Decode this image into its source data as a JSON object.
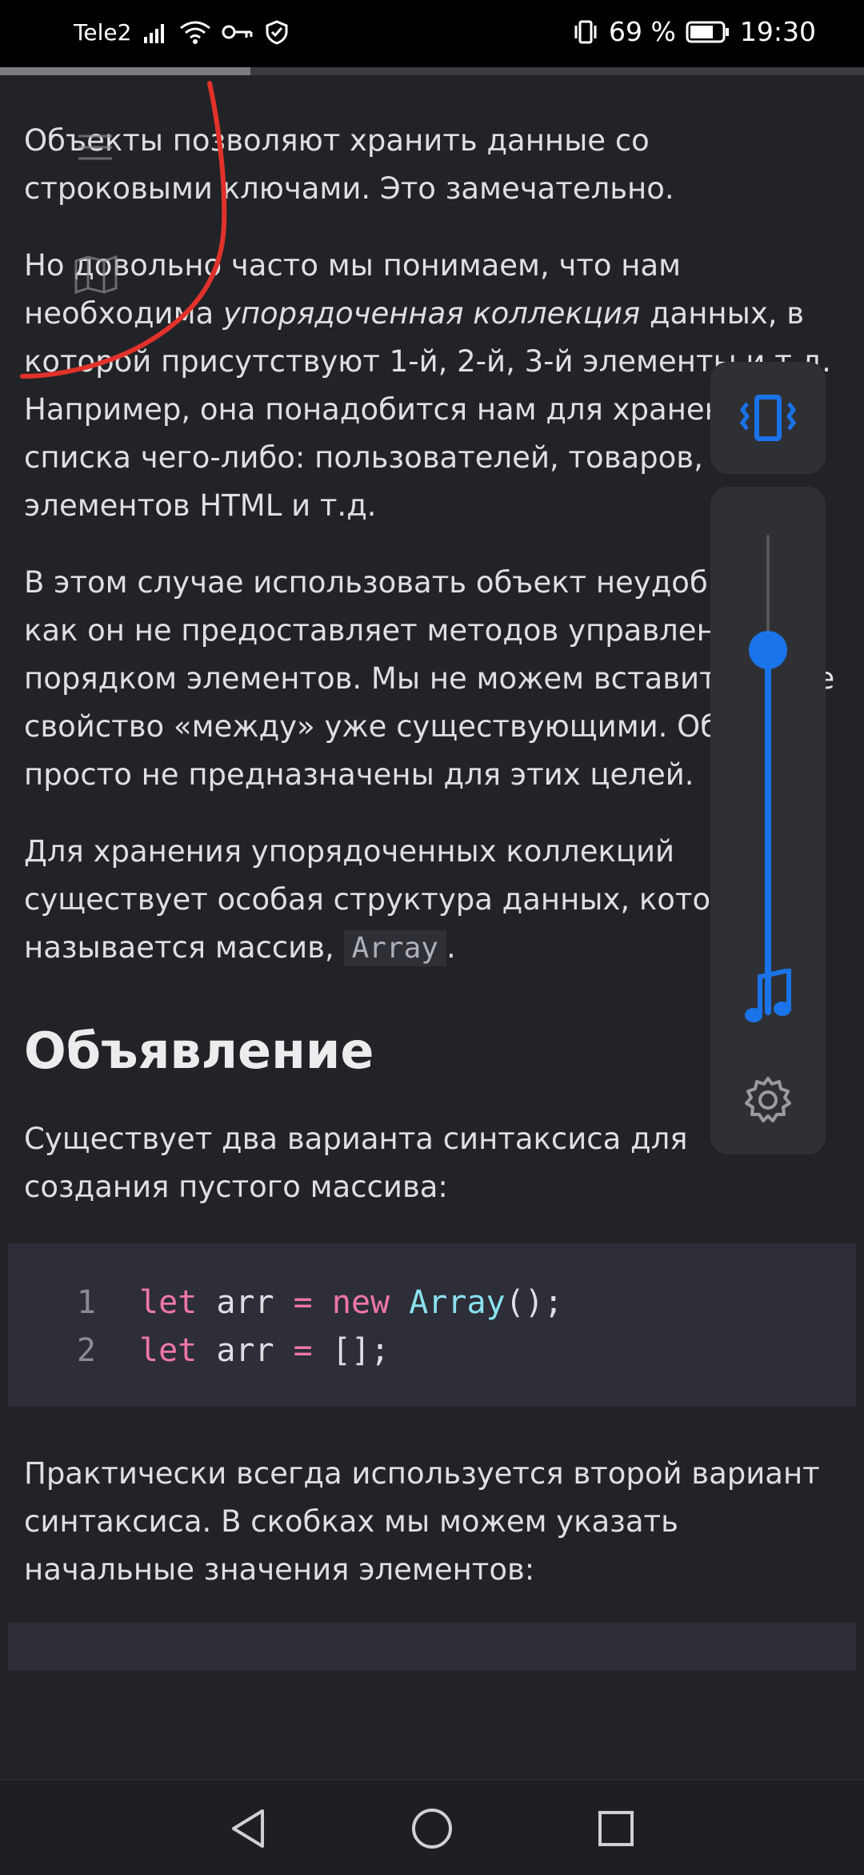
{
  "status_bar": {
    "carrier": "Tele2",
    "battery": "69 %",
    "time": "19:30"
  },
  "reading_progress": 0.29,
  "article": {
    "p1": "Объекты позволяют хранить данные со строковыми ключами. Это замечательно.",
    "p2_a": "Но довольно часто мы понимаем, что нам необходима ",
    "p2_em": "упорядоченная коллекция",
    "p2_b": " данных, в которой присутствуют 1-й, 2-й, 3-й элементы и т.д. Например, она понадобится нам для хранения списка чего-либо: пользователей, товаров, элементов HTML и т.д.",
    "p3": "В этом случае использовать объект неудобно, так как он не предоставляет методов управления порядком элементов. Мы не можем вставить новое свойство «между» уже существующими. Объекты просто не предназначены для этих целей.",
    "p4_a": "Для хранения упорядоченных коллекций существует особая структура данных, которая называется массив, ",
    "p4_code": "Array",
    "p4_b": ".",
    "heading": "Объявление",
    "p5": "Существует два варианта синтаксиса для создания пустого массива:",
    "code": {
      "line1_no": "1",
      "line1_kw": "let",
      "line1_var": " arr ",
      "line1_op": "=",
      "line1_new": "new",
      "line1_fn": "Array",
      "line1_end": "();",
      "line2_no": "2",
      "line2_kw": "let",
      "line2_var": " arr ",
      "line2_op": "=",
      "line2_end": " [];"
    },
    "p6": "Практически всегда используется второй вариант синтаксиса. В скобках мы можем указать начальные значения элементов:"
  },
  "volume_panel": {
    "level": 0.76,
    "accent": "#1a73e8",
    "icons": [
      "vibrate-icon",
      "music-note-icon",
      "gear-icon"
    ]
  },
  "nav": {
    "icons": [
      "back-icon",
      "home-icon",
      "recents-icon"
    ]
  }
}
